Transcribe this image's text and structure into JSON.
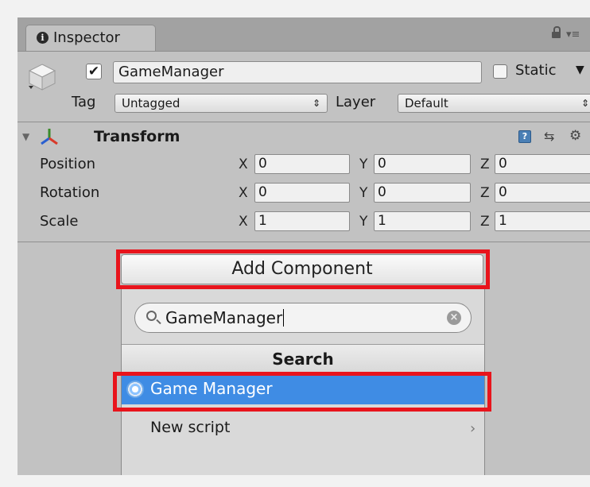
{
  "tab": {
    "title": "Inspector",
    "info_icon": "info-icon"
  },
  "header": {
    "object_name": "GameManager",
    "active": true,
    "static_label": "Static",
    "static_checked": false,
    "tag_label": "Tag",
    "tag_value": "Untagged",
    "layer_label": "Layer",
    "layer_value": "Default"
  },
  "transform": {
    "title": "Transform",
    "rows": [
      {
        "label": "Position",
        "x": "0",
        "y": "0",
        "z": "0"
      },
      {
        "label": "Rotation",
        "x": "0",
        "y": "0",
        "z": "0"
      },
      {
        "label": "Scale",
        "x": "1",
        "y": "1",
        "z": "1"
      }
    ],
    "axis_labels": {
      "x": "X",
      "y": "Y",
      "z": "Z"
    }
  },
  "add_component": {
    "button_label": "Add Component",
    "search_value": "GameManager",
    "section_title": "Search",
    "results": [
      {
        "label": "Game Manager",
        "selected": true
      }
    ],
    "new_script_label": "New script"
  },
  "colors": {
    "highlight": "#e8141c",
    "selection": "#3f8ce4",
    "panel": "#c2c2c2"
  }
}
